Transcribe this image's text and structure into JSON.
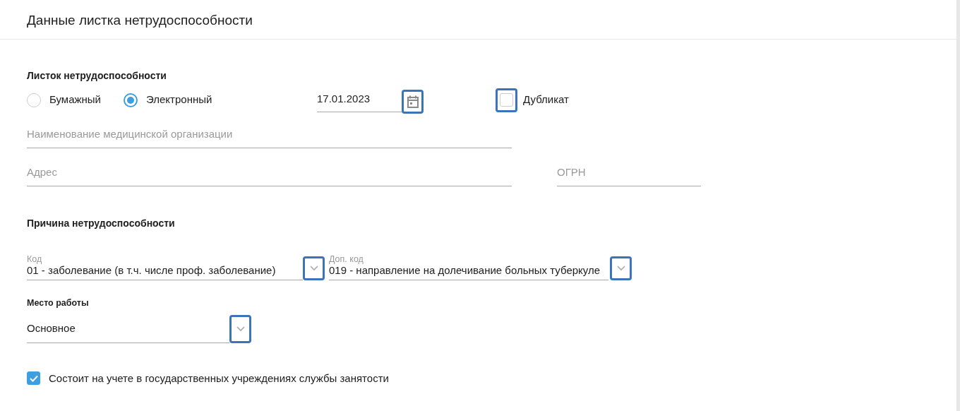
{
  "header": {
    "title": "Данные листка нетрудоспособности"
  },
  "sheet": {
    "heading": "Листок нетрудоспособности",
    "type_options": [
      {
        "label": "Бумажный",
        "selected": false
      },
      {
        "label": "Электронный",
        "selected": true
      }
    ],
    "date": {
      "value": "17.01.2023"
    },
    "duplicate": {
      "label": "Дубликат",
      "checked": false
    },
    "organization": {
      "placeholder": "Наименование медицинской организации"
    },
    "address": {
      "placeholder": "Адрес"
    },
    "ogrn": {
      "placeholder": "ОГРН"
    }
  },
  "reason": {
    "heading": "Причина нетрудоспособности",
    "code": {
      "label": "Код",
      "value": "01 - заболевание (в т.ч. числе проф. заболевание)"
    },
    "extra_code": {
      "label": "Доп. код",
      "value": "019 - направление на долечивание больных туберкуле"
    }
  },
  "workplace": {
    "label": "Место работы",
    "value": "Основное"
  },
  "employment_registered": {
    "label": "Состоит на учете в государственных учреждениях службы занятости",
    "checked": true
  }
}
